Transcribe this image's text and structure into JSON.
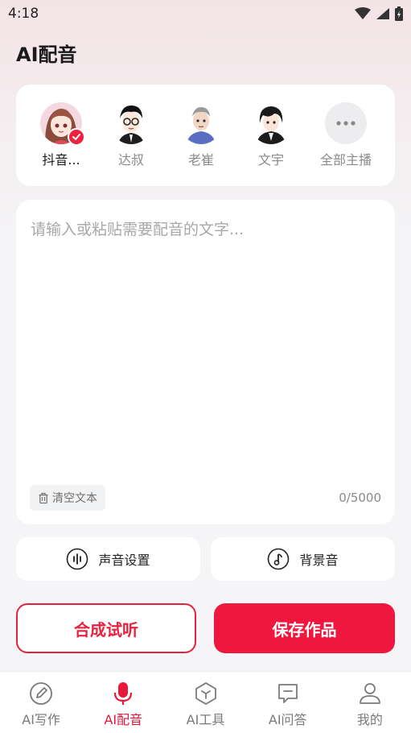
{
  "status_bar": {
    "time": "4:18"
  },
  "header": {
    "title": "AI配音"
  },
  "voices": [
    {
      "label": "抖音...",
      "selected": true
    },
    {
      "label": "达叔",
      "selected": false
    },
    {
      "label": "老崔",
      "selected": false
    },
    {
      "label": "文宇",
      "selected": false
    },
    {
      "label": "全部主播",
      "selected": false
    }
  ],
  "editor": {
    "placeholder": "请输入或粘贴需要配音的文字...",
    "clear_label": "清空文本",
    "char_count": "0/5000"
  },
  "settings": {
    "voice_settings_label": "声音设置",
    "background_music_label": "背景音"
  },
  "actions": {
    "preview_label": "合成试听",
    "save_label": "保存作品"
  },
  "tabs": [
    {
      "label": "AI写作",
      "icon": "pencil-icon",
      "active": false
    },
    {
      "label": "AI配音",
      "icon": "microphone-icon",
      "active": true
    },
    {
      "label": "AI工具",
      "icon": "cube-icon",
      "active": false
    },
    {
      "label": "AI问答",
      "icon": "chat-icon",
      "active": false
    },
    {
      "label": "我的",
      "icon": "user-icon",
      "active": false
    }
  ],
  "colors": {
    "accent": "#f0173e",
    "background": "#f5f5f7"
  }
}
